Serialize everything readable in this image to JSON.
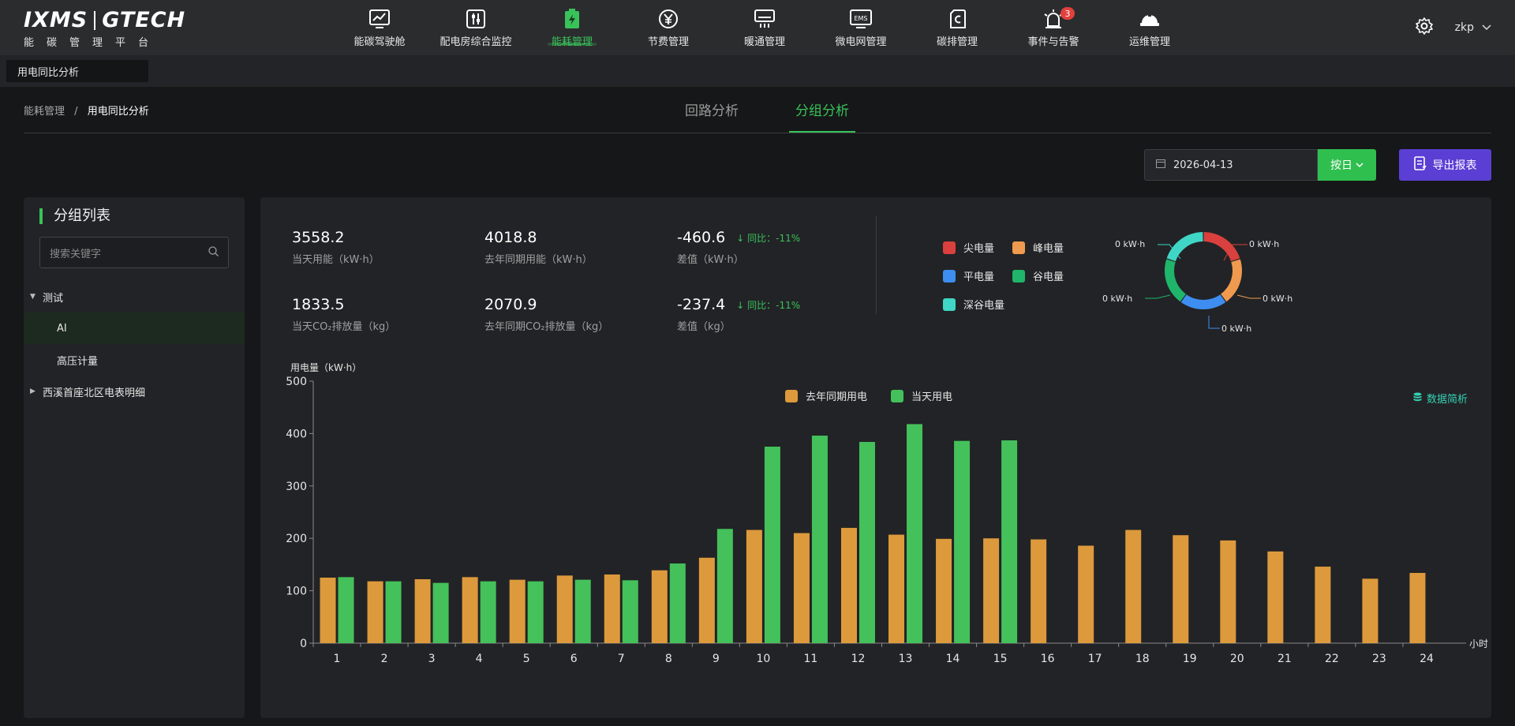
{
  "header": {
    "logo_main_left": "IXMS",
    "logo_main_right": "GTECH",
    "logo_sub": "能碳管理平台",
    "nav": [
      {
        "label": "能碳驾驶舱",
        "icon": "chart-trend-icon"
      },
      {
        "label": "配电房综合监控",
        "icon": "switch-panel-icon"
      },
      {
        "label": "能耗管理",
        "icon": "battery-icon",
        "active": true
      },
      {
        "label": "节费管理",
        "icon": "yen-coin-icon"
      },
      {
        "label": "暖通管理",
        "icon": "hvac-icon"
      },
      {
        "label": "微电网管理",
        "icon": "ems-icon"
      },
      {
        "label": "碳排管理",
        "icon": "carbon-icon"
      },
      {
        "label": "事件与告警",
        "icon": "alarm-icon",
        "badge": "3"
      },
      {
        "label": "运维管理",
        "icon": "helmet-icon"
      }
    ],
    "user": "zkp"
  },
  "tabs": {
    "page_tab": "用电同比分析"
  },
  "breadcrumb": {
    "parent": "能耗管理",
    "separator": "/",
    "current": "用电同比分析"
  },
  "center_tabs": [
    {
      "label": "回路分析"
    },
    {
      "label": "分组分析",
      "active": true
    }
  ],
  "toolbar": {
    "date": "2026-04-13",
    "day_button": "按日",
    "export_button": "导出报表"
  },
  "group_list": {
    "title": "分组列表",
    "search_placeholder": "搜索关键字",
    "tree": [
      {
        "label": "测试",
        "expanded": true
      },
      {
        "label": "AI",
        "selected": true
      },
      {
        "label": "高压计量"
      },
      {
        "label": "西溪首座北区电表明细",
        "expanded": false
      }
    ]
  },
  "stats": {
    "today_energy": {
      "value": "3558.2",
      "label": "当天用能（kW·h）"
    },
    "last_year_energy": {
      "value": "4018.8",
      "label": "去年同期用能（kW·h）"
    },
    "diff_energy": {
      "value": "-460.6",
      "label": "差值（kW·h）",
      "yoy": "↓ 同比：-11%"
    },
    "today_co2": {
      "value": "1833.5",
      "label": "当天CO₂排放量（kg）"
    },
    "last_year_co2": {
      "value": "2070.9",
      "label": "去年同期CO₂排放量（kg）"
    },
    "diff_co2": {
      "value": "-237.4",
      "label": "差值（kg）",
      "yoy": "↓ 同比：-11%"
    }
  },
  "tariff_legend": [
    {
      "label": "尖电量",
      "color": "#d9403e"
    },
    {
      "label": "峰电量",
      "color": "#ef9a4e"
    },
    {
      "label": "平电量",
      "color": "#3d8ef0"
    },
    {
      "label": "谷电量",
      "color": "#1fb56a"
    },
    {
      "label": "深谷电量",
      "color": "#3fd6c6"
    }
  ],
  "donut_labels": [
    "0 kW·h",
    "0 kW·h",
    "0 kW·h",
    "0 kW·h",
    "0 kW·h"
  ],
  "chart_data": {
    "type": "bar",
    "ylabel": "用电量（kW·h）",
    "xlabel": "小时",
    "ylim": [
      0,
      500
    ],
    "yticks": [
      0,
      100,
      200,
      300,
      400,
      500
    ],
    "categories": [
      "1",
      "2",
      "3",
      "4",
      "5",
      "6",
      "7",
      "8",
      "9",
      "10",
      "11",
      "12",
      "13",
      "14",
      "15",
      "16",
      "17",
      "18",
      "19",
      "20",
      "21",
      "22",
      "23",
      "24"
    ],
    "series": [
      {
        "name": "去年同期用电",
        "color": "#dd9a3c",
        "values": [
          125,
          118,
          122,
          126,
          121,
          129,
          131,
          139,
          163,
          216,
          210,
          220,
          207,
          199,
          200,
          198,
          186,
          216,
          206,
          196,
          175,
          146,
          123,
          134
        ]
      },
      {
        "name": "当天用电",
        "color": "#44c15a",
        "values": [
          126,
          118,
          115,
          118,
          118,
          121,
          120,
          152,
          218,
          375,
          396,
          384,
          418,
          386,
          387,
          null,
          null,
          null,
          null,
          null,
          null,
          null,
          null,
          null
        ]
      }
    ],
    "legend_position": "top-center",
    "grid": false
  },
  "data_brief": "数据简析"
}
